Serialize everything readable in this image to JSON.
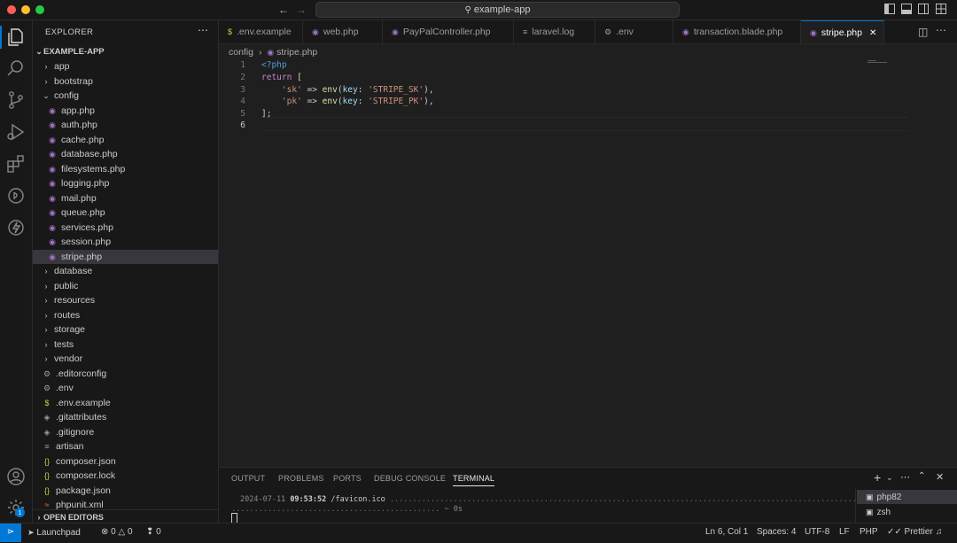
{
  "window": {
    "search": "example-app"
  },
  "sidebar": {
    "header": "EXPLORER",
    "more": "⋯",
    "root": "EXAMPLE-APP",
    "items": [
      {
        "label": "app",
        "type": "folder",
        "open": false,
        "depth": 1
      },
      {
        "label": "bootstrap",
        "type": "folder",
        "open": false,
        "depth": 1
      },
      {
        "label": "config",
        "type": "folder",
        "open": true,
        "depth": 1
      },
      {
        "label": "app.php",
        "type": "php",
        "depth": 2
      },
      {
        "label": "auth.php",
        "type": "php",
        "depth": 2
      },
      {
        "label": "cache.php",
        "type": "php",
        "depth": 2
      },
      {
        "label": "database.php",
        "type": "php",
        "depth": 2
      },
      {
        "label": "filesystems.php",
        "type": "php",
        "depth": 2
      },
      {
        "label": "logging.php",
        "type": "php",
        "depth": 2
      },
      {
        "label": "mail.php",
        "type": "php",
        "depth": 2
      },
      {
        "label": "queue.php",
        "type": "php",
        "depth": 2
      },
      {
        "label": "services.php",
        "type": "php",
        "depth": 2
      },
      {
        "label": "session.php",
        "type": "php",
        "depth": 2
      },
      {
        "label": "stripe.php",
        "type": "php",
        "depth": 2,
        "selected": true
      },
      {
        "label": "database",
        "type": "folder",
        "open": false,
        "depth": 1
      },
      {
        "label": "public",
        "type": "folder",
        "open": false,
        "depth": 1
      },
      {
        "label": "resources",
        "type": "folder",
        "open": false,
        "depth": 1
      },
      {
        "label": "routes",
        "type": "folder",
        "open": false,
        "depth": 1
      },
      {
        "label": "storage",
        "type": "folder",
        "open": false,
        "depth": 1
      },
      {
        "label": "tests",
        "type": "folder",
        "open": false,
        "depth": 1
      },
      {
        "label": "vendor",
        "type": "folder",
        "open": false,
        "depth": 1
      },
      {
        "label": ".editorconfig",
        "type": "gear",
        "depth": 1
      },
      {
        "label": ".env",
        "type": "gear",
        "depth": 1
      },
      {
        "label": ".env.example",
        "type": "dollar",
        "depth": 1
      },
      {
        "label": ".gitattributes",
        "type": "git",
        "depth": 1
      },
      {
        "label": ".gitignore",
        "type": "git",
        "depth": 1
      },
      {
        "label": "artisan",
        "type": "lines",
        "depth": 1
      },
      {
        "label": "composer.json",
        "type": "json",
        "depth": 1
      },
      {
        "label": "composer.lock",
        "type": "json",
        "depth": 1
      },
      {
        "label": "package.json",
        "type": "json",
        "depth": 1
      },
      {
        "label": "phpunit.xml",
        "type": "xml",
        "depth": 1
      }
    ],
    "open_editors": "OPEN EDITORS"
  },
  "tabs": [
    {
      "label": ".env.example",
      "icon": "dollar"
    },
    {
      "label": "web.php",
      "icon": "php"
    },
    {
      "label": "PayPalController.php",
      "icon": "php"
    },
    {
      "label": "laravel.log",
      "icon": "lines"
    },
    {
      "label": ".env",
      "icon": "gear"
    },
    {
      "label": "transaction.blade.php",
      "icon": "php"
    },
    {
      "label": "stripe.php",
      "icon": "php",
      "active": true
    }
  ],
  "breadcrumb": {
    "folder": "config",
    "file": "stripe.php"
  },
  "code": {
    "line_numbers": [
      "1",
      "2",
      "3",
      "4",
      "5",
      "6"
    ],
    "current_line": "6"
  },
  "panel": {
    "tabs": [
      "OUTPUT",
      "PROBLEMS",
      "PORTS",
      "DEBUG CONSOLE",
      "TERMINAL"
    ],
    "active_tab": "TERMINAL",
    "log_date": "2024-07-11",
    "log_time": "09:53:52",
    "log_path": "/favicon.ico",
    "log_duration": "~ 0s",
    "terminals": [
      "php82",
      "zsh"
    ]
  },
  "status": {
    "launchpad": "Launchpad",
    "errors": "0",
    "warnings": "0",
    "ports": "0",
    "position": "Ln 6, Col 1",
    "spaces": "Spaces: 4",
    "encoding": "UTF-8",
    "eol": "LF",
    "language": "PHP",
    "formatter": "Prettier"
  },
  "accounts_badge": "1"
}
